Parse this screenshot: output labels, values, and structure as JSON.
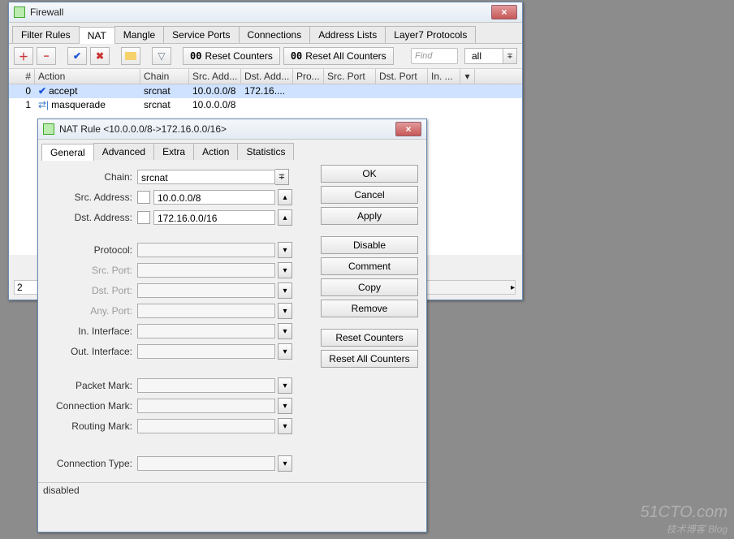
{
  "firewall_window": {
    "title": "Firewall",
    "close_icon": "×",
    "tabs": [
      "Filter Rules",
      "NAT",
      "Mangle",
      "Service Ports",
      "Connections",
      "Address Lists",
      "Layer7 Protocols"
    ],
    "active_tab": 1,
    "toolbar": {
      "reset_counters": "Reset Counters",
      "reset_all_counters": "Reset All Counters",
      "find_placeholder": "Find",
      "filter_value": "all"
    },
    "column_headers": [
      "#",
      "Action",
      "Chain",
      "Src. Add...",
      "Dst. Add...",
      "Pro...",
      "Src. Port",
      "Dst. Port",
      "In. ..."
    ],
    "rows": [
      {
        "num": "0",
        "action": "accept",
        "chain": "srcnat",
        "src": "10.0.0.0/8",
        "dst": "172.16....",
        "selected": true,
        "icon": "accept"
      },
      {
        "num": "1",
        "action": "masquerade",
        "chain": "srcnat",
        "src": "10.0.0.0/8",
        "dst": "",
        "selected": false,
        "icon": "masquerade"
      }
    ],
    "status": "2"
  },
  "nat_rule_dialog": {
    "title": "NAT Rule <10.0.0.0/8->172.16.0.0/16>",
    "tabs": [
      "General",
      "Advanced",
      "Extra",
      "Action",
      "Statistics"
    ],
    "active_tab": 0,
    "fields": {
      "chain": {
        "label": "Chain:",
        "value": "srcnat"
      },
      "src_address": {
        "label": "Src. Address:",
        "value": "10.0.0.0/8"
      },
      "dst_address": {
        "label": "Dst. Address:",
        "value": "172.16.0.0/16"
      },
      "protocol": {
        "label": "Protocol:",
        "value": ""
      },
      "src_port": {
        "label": "Src. Port:",
        "value": "",
        "dim": true
      },
      "dst_port": {
        "label": "Dst. Port:",
        "value": "",
        "dim": true
      },
      "any_port": {
        "label": "Any. Port:",
        "value": "",
        "dim": true
      },
      "in_interface": {
        "label": "In. Interface:",
        "value": ""
      },
      "out_interface": {
        "label": "Out. Interface:",
        "value": ""
      },
      "packet_mark": {
        "label": "Packet Mark:",
        "value": ""
      },
      "connection_mark": {
        "label": "Connection Mark:",
        "value": ""
      },
      "routing_mark": {
        "label": "Routing Mark:",
        "value": ""
      },
      "connection_type": {
        "label": "Connection Type:",
        "value": ""
      }
    },
    "buttons": {
      "ok": "OK",
      "cancel": "Cancel",
      "apply": "Apply",
      "disable": "Disable",
      "comment": "Comment",
      "copy": "Copy",
      "remove": "Remove",
      "reset_counters": "Reset Counters",
      "reset_all_counters": "Reset All Counters"
    },
    "status": "disabled"
  },
  "watermark": {
    "main": "51CTO.com",
    "sub": "技术博客    Blog"
  }
}
